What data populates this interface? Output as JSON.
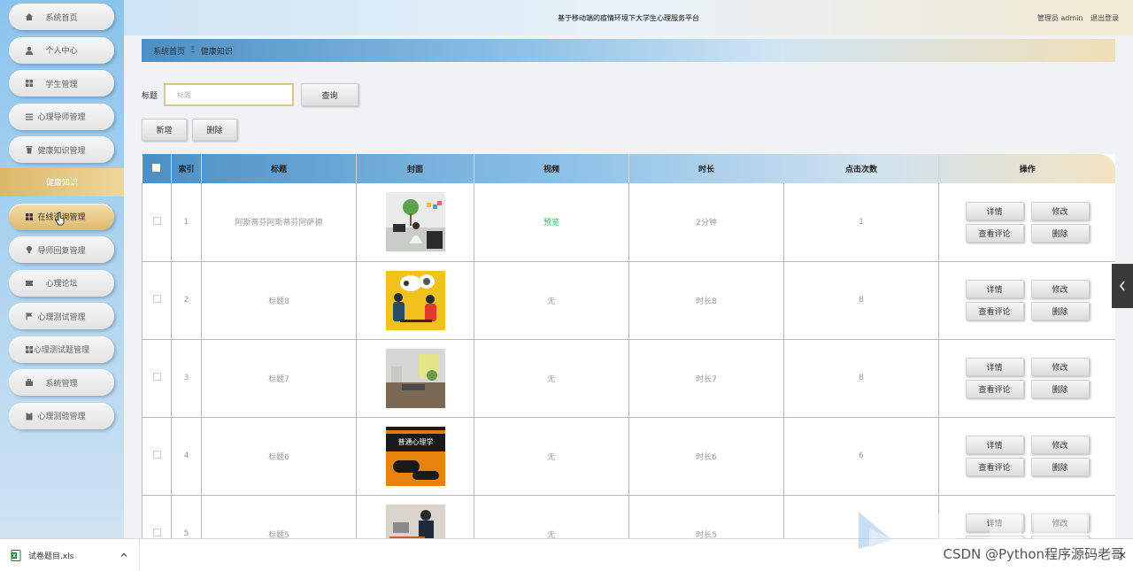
{
  "sidebar": {
    "items": [
      {
        "label": "系统首页",
        "icon": "home-icon"
      },
      {
        "label": "个人中心",
        "icon": "user-icon"
      },
      {
        "label": "学生管理",
        "icon": "grid-icon"
      },
      {
        "label": "心理导师管理",
        "icon": "list-icon"
      },
      {
        "label": "健康知识管理",
        "icon": "trash-icon"
      }
    ],
    "submenu_label": "健康知识",
    "items_after": [
      {
        "label": "在线咨询管理",
        "icon": "grid-icon"
      },
      {
        "label": "导师回复管理",
        "icon": "bulb-icon"
      },
      {
        "label": "心理论坛",
        "icon": "ticket-icon"
      },
      {
        "label": "心理测试管理",
        "icon": "flag-icon"
      },
      {
        "label": "心理测试题管理",
        "icon": "grid-icon"
      },
      {
        "label": "系统管理",
        "icon": "briefcase-icon"
      },
      {
        "label": "心理测验管理",
        "icon": "clipboard-icon"
      }
    ]
  },
  "header": {
    "title": "基于移动端的疫情环境下大学生心理服务平台",
    "user_label": "管理员 admin",
    "logout_label": "退出登录"
  },
  "breadcrumb": {
    "home": "系统首页",
    "separator": "Ξ",
    "current": "健康知识"
  },
  "search": {
    "label": "标题",
    "placeholder": "标题",
    "query_button": "查询"
  },
  "actions": {
    "add": "新增",
    "delete": "删除"
  },
  "table": {
    "headers": [
      "索引",
      "标题",
      "封面",
      "视频",
      "时长",
      "点击次数",
      "操作"
    ],
    "rows": [
      {
        "index": "1",
        "title": "阿斯蒂芬阿斯蒂芬阿萨德",
        "video": "预览",
        "duration": "2分钟",
        "clicks": "1"
      },
      {
        "index": "2",
        "title": "标题8",
        "video": "无",
        "duration": "时长8",
        "clicks": "8"
      },
      {
        "index": "3",
        "title": "标题7",
        "video": "无",
        "duration": "时长7",
        "clicks": "8"
      },
      {
        "index": "4",
        "title": "标题6",
        "video": "无",
        "duration": "时长6",
        "clicks": "6",
        "cover_text": "普通心理学"
      },
      {
        "index": "5",
        "title": "标题5",
        "video": "无",
        "duration": "时长5",
        "clicks": ""
      }
    ],
    "op_labels": {
      "detail": "详情",
      "edit": "修改",
      "comments": "查看评论",
      "delete": "删除"
    }
  },
  "download_bar": {
    "file_name": "试卷题目.xls",
    "close": "×"
  },
  "watermark": {
    "text": "CSDN @Python程序源码老哥"
  },
  "colors": {
    "sidebar_top": "#8ac4ec",
    "active_gold": "#dcb96c",
    "header_blue": "#4c8fc5",
    "video_green": "#43b06b"
  }
}
